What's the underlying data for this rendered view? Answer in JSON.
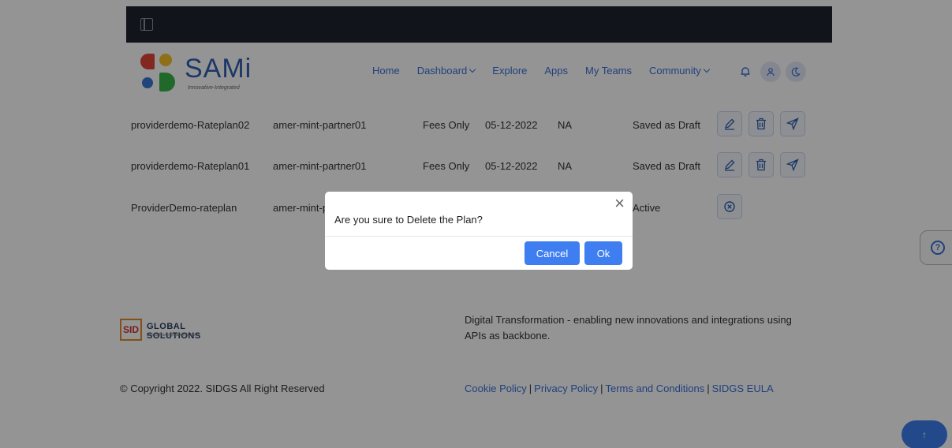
{
  "nav": {
    "brand": "SAMi",
    "tagline": "Innovative-Integrated",
    "menu": [
      "Home",
      "Dashboard",
      "Explore",
      "Apps",
      "My Teams",
      "Community"
    ]
  },
  "rows": [
    {
      "name": "providerdemo-Rateplan02",
      "partner": "amer-mint-partner01",
      "type": "Fees Only",
      "date": "05-12-2022",
      "na": "NA",
      "status": "Saved as Draft"
    },
    {
      "name": "providerdemo-Rateplan01",
      "partner": "amer-mint-partner01",
      "type": "Fees Only",
      "date": "05-12-2022",
      "na": "NA",
      "status": "Saved as Draft"
    },
    {
      "name": "ProviderDemo-rateplan",
      "partner": "amer-mint-p",
      "status": "Active"
    }
  ],
  "footer": {
    "sid_mark": "SID",
    "sid_title": "GLOBAL SOLUTIONS",
    "sid_sub": "Digital Transformation Experts",
    "description": "Digital Transformation - enabling new innovations and integrations using APIs as backbone.",
    "copyright": "© Copyright 2022. SIDGS All Right Reserved",
    "links": [
      "Cookie Policy",
      "Privacy Policy",
      "Terms and Conditions",
      "SIDGS EULA"
    ]
  },
  "modal": {
    "message": "Are you sure to Delete the Plan?",
    "cancel": "Cancel",
    "ok": "Ok",
    "close": "×"
  },
  "icons": {
    "help": "?",
    "to_top": "↑"
  },
  "colors": {
    "accent": "#3f7ef0",
    "topbar": "#1e2330"
  }
}
